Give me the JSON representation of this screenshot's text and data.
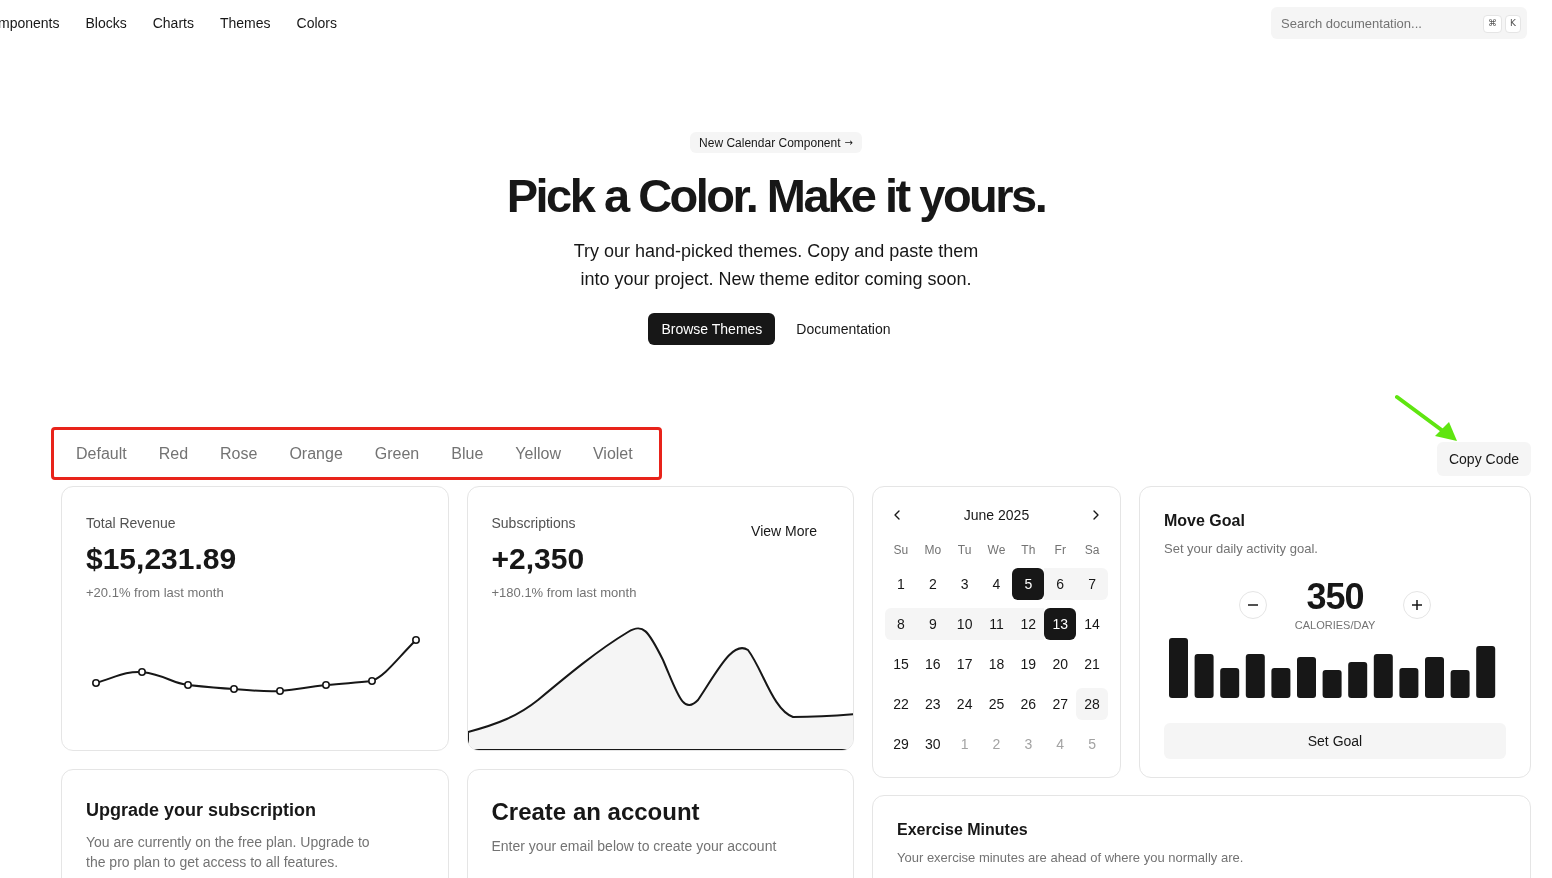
{
  "nav": {
    "links": [
      "mponents",
      "Blocks",
      "Charts",
      "Themes",
      "Colors"
    ],
    "search": {
      "placeholder": "Search documentation...",
      "keys": [
        "⌘",
        "K"
      ]
    }
  },
  "hero": {
    "badge": "New Calendar Component",
    "badge_arrow": "→",
    "title": "Pick a Color. Make it yours.",
    "subtitle_lines": [
      "Try our hand-picked themes. Copy and paste them",
      "into your project. New theme editor coming soon."
    ],
    "buttons": [
      {
        "label": "Browse Themes",
        "kind": "primary"
      },
      {
        "label": "Documentation",
        "kind": "ghost"
      }
    ]
  },
  "theme_tabs": [
    {
      "label": "Default",
      "selected": false
    },
    {
      "label": "Red",
      "selected": false
    },
    {
      "label": "Rose",
      "selected": false
    },
    {
      "label": "Orange",
      "selected": false
    },
    {
      "label": "Green",
      "selected": false
    },
    {
      "label": "Blue",
      "selected": false
    },
    {
      "label": "Yellow",
      "selected": false
    },
    {
      "label": "Violet",
      "selected": false
    }
  ],
  "copy_button": "Copy Code",
  "revenue": {
    "label": "Total Revenue",
    "value": "$15,231.89",
    "change": "+20.1% from last month"
  },
  "subscriptions": {
    "label": "Subscriptions",
    "value": "+2,350",
    "change": "+180.1% from last month",
    "link": "View More"
  },
  "calendar": {
    "month": "June 2025",
    "weekdays": [
      "Su",
      "Mo",
      "Tu",
      "We",
      "Th",
      "Fr",
      "Sa"
    ],
    "weeks": [
      [
        {
          "day": "1",
          "kind": "normal"
        },
        {
          "day": "2",
          "kind": "normal"
        },
        {
          "day": "3",
          "kind": "normal"
        },
        {
          "day": "4",
          "kind": "normal"
        },
        {
          "day": "5",
          "kind": "selected"
        },
        {
          "day": "6",
          "kind": "range"
        },
        {
          "day": "7",
          "kind": "range"
        }
      ],
      [
        {
          "day": "8",
          "kind": "range"
        },
        {
          "day": "9",
          "kind": "range"
        },
        {
          "day": "10",
          "kind": "range"
        },
        {
          "day": "11",
          "kind": "range"
        },
        {
          "day": "12",
          "kind": "range"
        },
        {
          "day": "13",
          "kind": "selected"
        },
        {
          "day": "14",
          "kind": "normal"
        }
      ],
      [
        {
          "day": "15",
          "kind": "normal"
        },
        {
          "day": "16",
          "kind": "normal"
        },
        {
          "day": "17",
          "kind": "normal"
        },
        {
          "day": "18",
          "kind": "normal"
        },
        {
          "day": "19",
          "kind": "normal"
        },
        {
          "day": "20",
          "kind": "normal"
        },
        {
          "day": "21",
          "kind": "normal"
        }
      ],
      [
        {
          "day": "22",
          "kind": "normal"
        },
        {
          "day": "23",
          "kind": "normal"
        },
        {
          "day": "24",
          "kind": "normal"
        },
        {
          "day": "25",
          "kind": "normal"
        },
        {
          "day": "26",
          "kind": "normal"
        },
        {
          "day": "27",
          "kind": "normal"
        },
        {
          "day": "28",
          "kind": "today"
        }
      ],
      [
        {
          "day": "29",
          "kind": "normal"
        },
        {
          "day": "30",
          "kind": "normal"
        },
        {
          "day": "1",
          "kind": "outside"
        },
        {
          "day": "2",
          "kind": "outside"
        },
        {
          "day": "3",
          "kind": "outside"
        },
        {
          "day": "4",
          "kind": "outside"
        },
        {
          "day": "5",
          "kind": "outside"
        }
      ]
    ]
  },
  "move_goal": {
    "title": "Move Goal",
    "description": "Set your daily activity goal.",
    "value": "350",
    "unit": "CALORIES/DAY",
    "button": "Set Goal"
  },
  "upgrade": {
    "title": "Upgrade your subscription",
    "description": "You are currently on the free plan. Upgrade to the pro plan to get access to all features."
  },
  "create_account": {
    "title": "Create an account",
    "description": "Enter your email below to create your account"
  },
  "exercise": {
    "title": "Exercise Minutes",
    "description": "Your exercise minutes are ahead of where you normally are."
  }
}
